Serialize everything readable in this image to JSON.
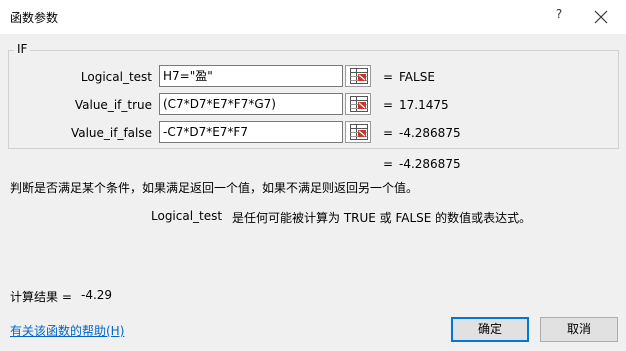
{
  "window": {
    "title": "函数参数",
    "help_glyph": "?",
    "close_icon": "close-icon"
  },
  "function_name": "IF",
  "arguments": [
    {
      "label": "Logical_test",
      "value": "H7=\"盈\"",
      "equals": "=",
      "result": "FALSE"
    },
    {
      "label": "Value_if_true",
      "value": "(C7*D7*E7*F7*G7)",
      "equals": "=",
      "result": "17.1475"
    },
    {
      "label": "Value_if_false",
      "value": "-C7*D7*E7*F7",
      "equals": "=",
      "result": "-4.286875"
    }
  ],
  "overall": {
    "equals": "=",
    "result": "-4.286875"
  },
  "description": "判断是否满足某个条件，如果满足返回一个值，如果不满足则返回另一个值。",
  "arg_description": {
    "name": "Logical_test",
    "text": "是任何可能被计算为 TRUE 或 FALSE 的数值或表达式。"
  },
  "calc_result": {
    "label": "计算结果 =",
    "value": "-4.29"
  },
  "help_link": "有关该函数的帮助(H)",
  "buttons": {
    "ok": "确定",
    "cancel": "取消"
  },
  "colors": {
    "accent": "#0078d7",
    "link": "#0066cc"
  }
}
